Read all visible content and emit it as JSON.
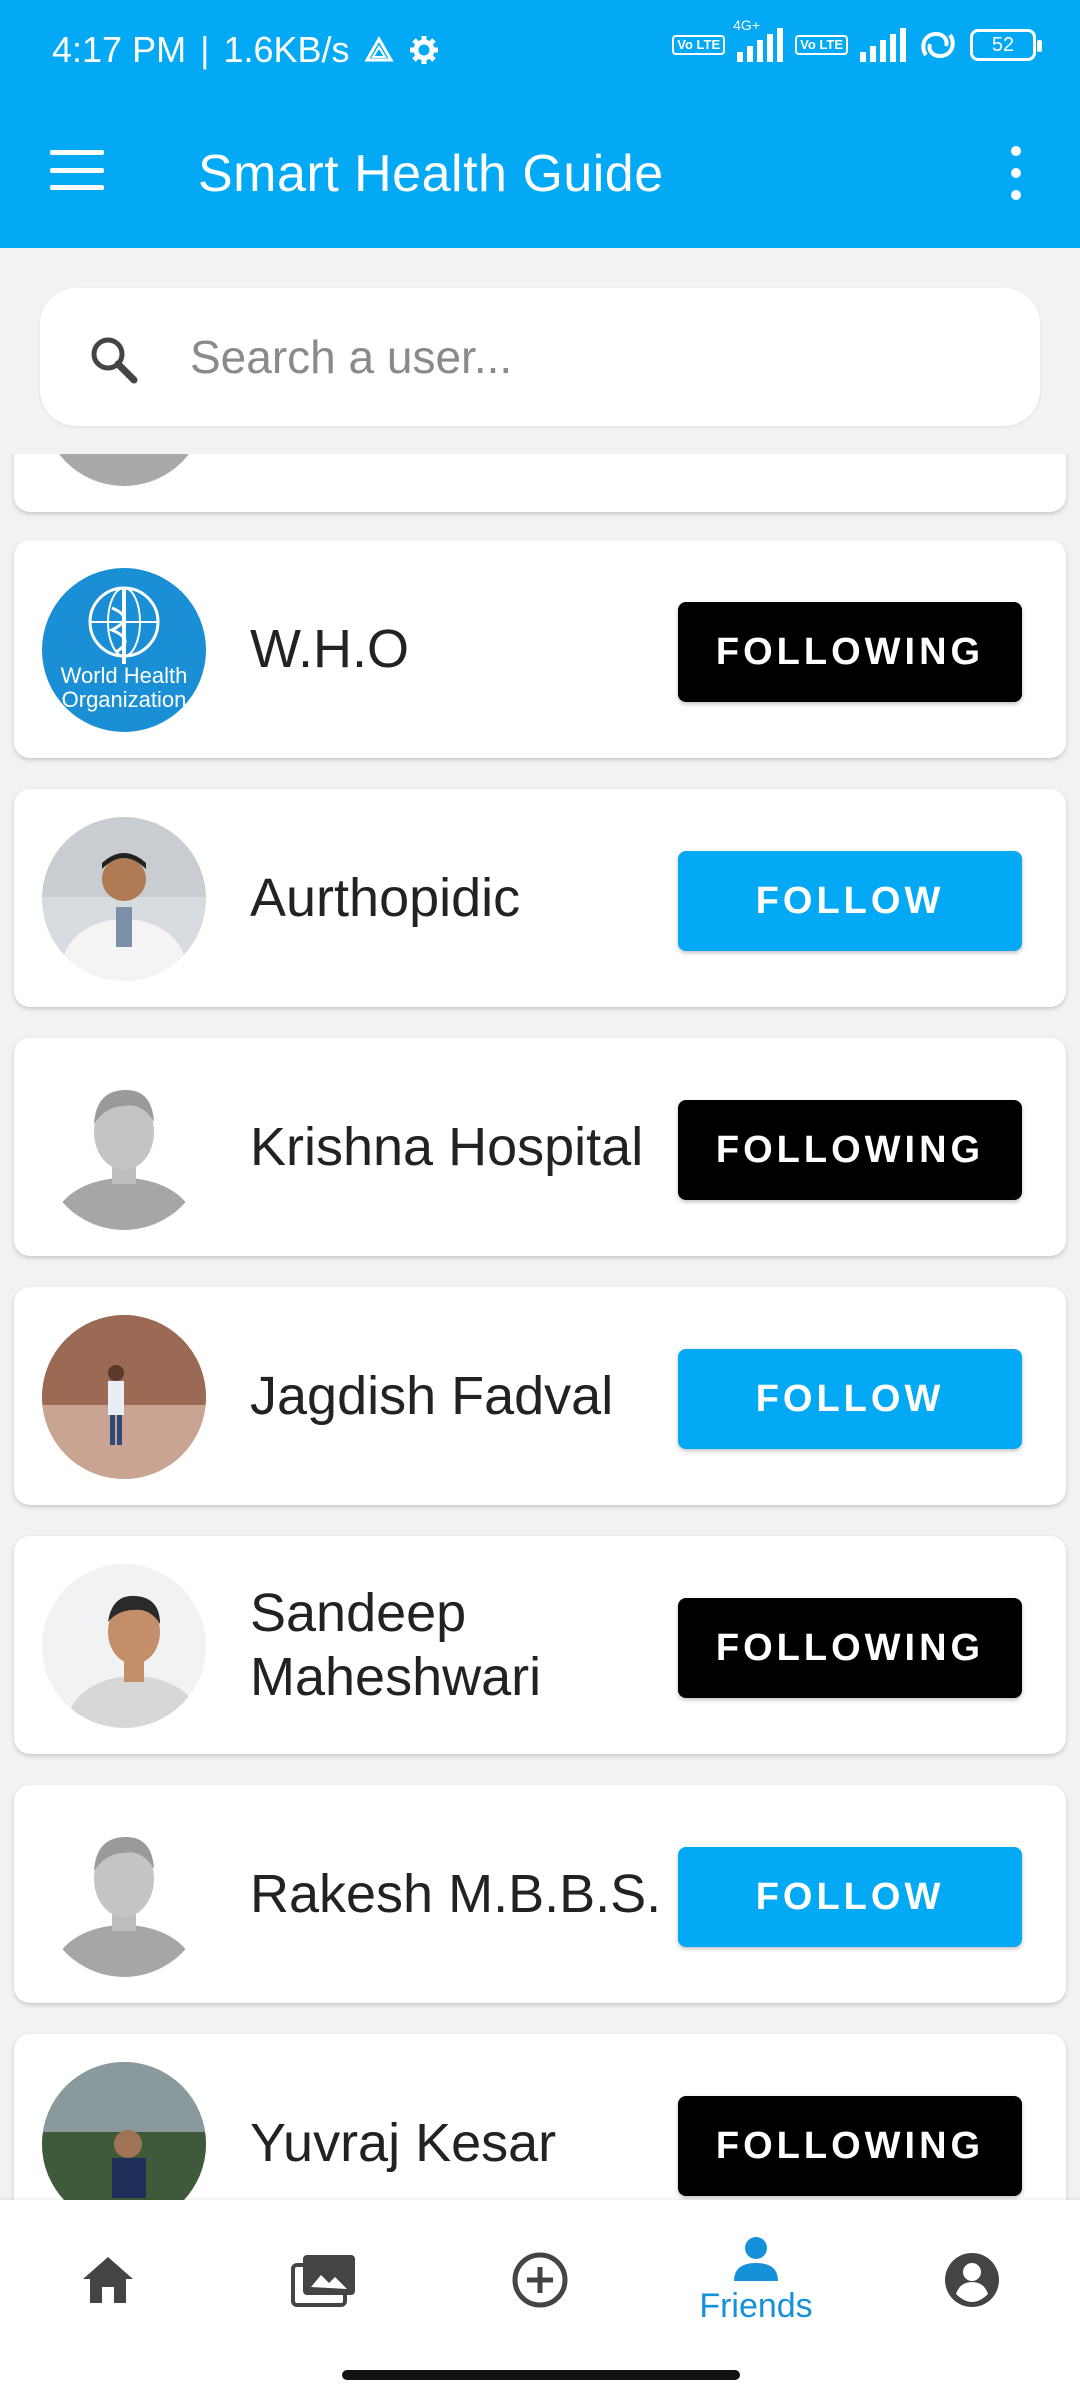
{
  "status_bar": {
    "time": "4:17 PM",
    "net_speed": "1.6KB/s",
    "network": "4G+",
    "volte": "Vo LTE",
    "battery": "52"
  },
  "app_bar": {
    "title": "Smart Health Guide"
  },
  "search": {
    "placeholder": "Search a user..."
  },
  "users": [
    {
      "name": "W.H.O",
      "button": "FOLLOWING",
      "state": "following",
      "avatar": "who-logo",
      "logo_text": "World Health Organization"
    },
    {
      "name": "Aurthopidic",
      "button": "FOLLOW",
      "state": "follow",
      "avatar": "photo-doctor"
    },
    {
      "name": "Krishna Hospital",
      "button": "FOLLOWING",
      "state": "following",
      "avatar": "placeholder-person"
    },
    {
      "name": "Jagdish Fadval",
      "button": "FOLLOW",
      "state": "follow",
      "avatar": "photo-man-temple"
    },
    {
      "name": "Sandeep Maheshwari",
      "button": "FOLLOWING",
      "state": "following",
      "avatar": "photo-man-sweater"
    },
    {
      "name": "Rakesh M.B.B.S.",
      "button": "FOLLOW",
      "state": "follow",
      "avatar": "placeholder-person"
    },
    {
      "name": "Yuvraj Kesar",
      "button": "FOLLOWING",
      "state": "following",
      "avatar": "photo-man-seated"
    }
  ],
  "bottom_nav": {
    "items": [
      {
        "icon": "home-icon"
      },
      {
        "icon": "photos-icon"
      },
      {
        "icon": "add-circle-icon"
      },
      {
        "icon": "friends-icon",
        "label": "Friends",
        "active": true
      },
      {
        "icon": "account-icon"
      }
    ]
  },
  "colors": {
    "primary": "#03a9f4",
    "following_button": "#000000",
    "follow_button": "#03a9f4",
    "active_nav": "#1591d9"
  }
}
